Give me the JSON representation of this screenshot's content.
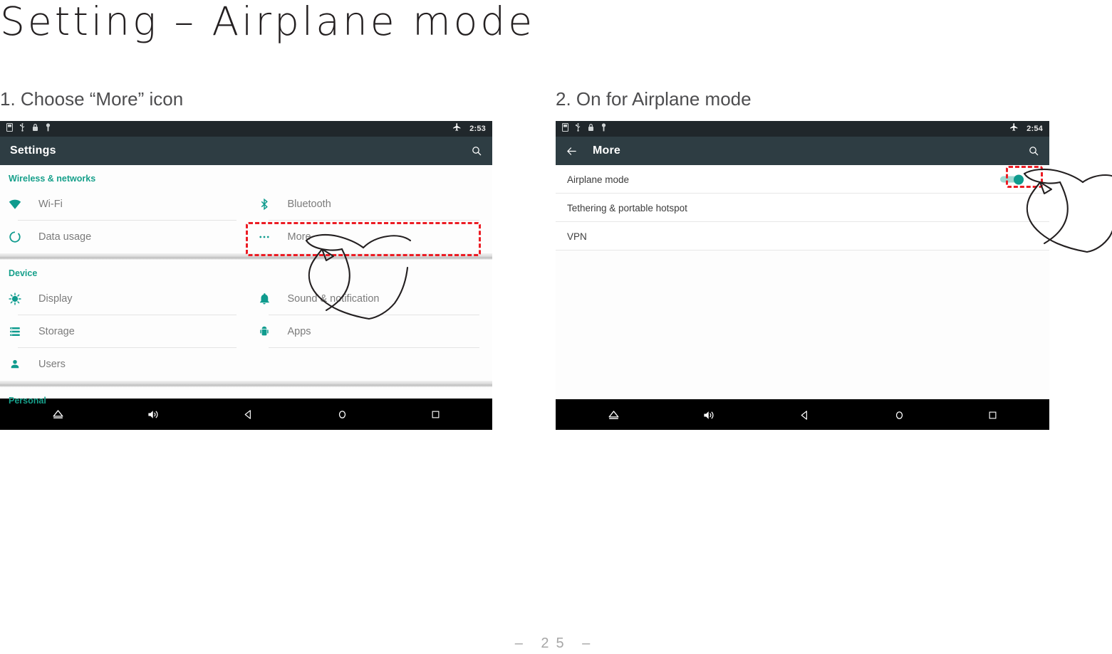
{
  "page": {
    "title": "Setting – Airplane mode",
    "footer": "–  25  –"
  },
  "colors": {
    "accent_teal": "#17a08b",
    "toggle_on": "#0f9b8e",
    "toggle_track": "#9fd9d2",
    "highlight_red": "#ec1c24",
    "action_bar": "#2e3d43",
    "status_bar": "#20272b",
    "nav_bar": "#000000",
    "title_text": "#231f20",
    "caption_text": "#4d4d4f"
  },
  "steps": [
    {
      "caption": "1. Choose “More” icon"
    },
    {
      "caption": "2. On for Airplane mode"
    }
  ],
  "panel1": {
    "status_bar": {
      "icons": [
        "sim-card-icon",
        "usb-icon",
        "lock-icon",
        "usb-debug-icon"
      ],
      "right_icons": [
        "airplane-icon"
      ],
      "time": "2:53"
    },
    "action_bar": {
      "title": "Settings",
      "search_icon": "search-icon"
    },
    "sections": [
      {
        "header": "Wireless & networks",
        "rows": [
          {
            "left": {
              "icon": "wifi-icon",
              "label": "Wi-Fi"
            },
            "right": {
              "icon": "bluetooth-icon",
              "label": "Bluetooth"
            }
          },
          {
            "left": {
              "icon": "data-usage-icon",
              "label": "Data usage"
            },
            "right": {
              "icon": "more-icon",
              "label": "More"
            }
          }
        ]
      },
      {
        "header": "Device",
        "rows": [
          {
            "left": {
              "icon": "display-icon",
              "label": "Display"
            },
            "right": {
              "icon": "bell-icon",
              "label": "Sound & notification"
            }
          },
          {
            "left": {
              "icon": "storage-icon",
              "label": "Storage"
            },
            "right": {
              "icon": "android-icon",
              "label": "Apps"
            }
          },
          {
            "left": {
              "icon": "user-icon",
              "label": "Users"
            },
            "right": {
              "icon": "",
              "label": ""
            }
          }
        ]
      },
      {
        "header": "Personal",
        "rows": []
      }
    ],
    "nav_bar": {
      "buttons": [
        "eject-icon",
        "volume-icon",
        "back-icon",
        "home-icon",
        "recents-icon"
      ]
    }
  },
  "panel2": {
    "status_bar": {
      "icons": [
        "sim-card-icon",
        "usb-icon",
        "lock-icon",
        "usb-debug-icon"
      ],
      "right_icons": [
        "airplane-icon"
      ],
      "time": "2:54"
    },
    "action_bar": {
      "back_icon": "arrow-left-icon",
      "title": "More",
      "search_icon": "search-icon"
    },
    "rows": [
      {
        "label": "Airplane mode",
        "toggle": "on"
      },
      {
        "label": "Tethering & portable hotspot",
        "toggle": null
      },
      {
        "label": "VPN",
        "toggle": null
      }
    ],
    "nav_bar": {
      "buttons": [
        "eject-icon",
        "volume-icon",
        "back-icon",
        "home-icon",
        "recents-icon"
      ]
    }
  }
}
